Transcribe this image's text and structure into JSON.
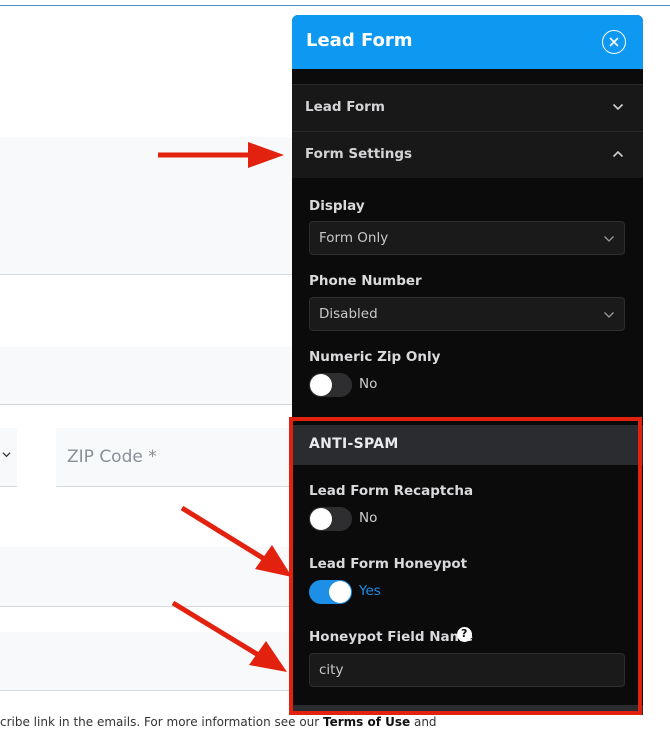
{
  "background": {
    "zip_placeholder": "ZIP Code *",
    "footer_text_prefix": "cribe link in the emails. For more information see our ",
    "footer_link": "Terms of Use",
    "footer_text_suffix": " and"
  },
  "panel": {
    "title": "Lead Form",
    "accordion": [
      {
        "label": "Lead Form",
        "state": "collapsed"
      },
      {
        "label": "Form Settings",
        "state": "expanded"
      }
    ],
    "form_settings": {
      "display_label": "Display",
      "display_value": "Form Only",
      "phone_label": "Phone Number",
      "phone_value": "Disabled",
      "numeric_zip_label": "Numeric Zip Only",
      "numeric_zip_value": "No"
    },
    "anti_spam": {
      "heading": "ANTI-SPAM",
      "recaptcha_label": "Lead Form Recaptcha",
      "recaptcha_value": "No",
      "honeypot_label": "Lead Form Honeypot",
      "honeypot_value": "Yes",
      "honeypot_field_label": "Honeypot Field Name",
      "honeypot_field_value": "city"
    }
  },
  "colors": {
    "header_blue": "#0d99f2",
    "panel_bg": "#0b0b0c",
    "toggle_on": "#1e8fe6",
    "annotation_red": "#e2210f"
  },
  "icons": [
    "close-circle-icon",
    "chevron-down-icon",
    "chevron-up-icon",
    "help-question-icon"
  ]
}
